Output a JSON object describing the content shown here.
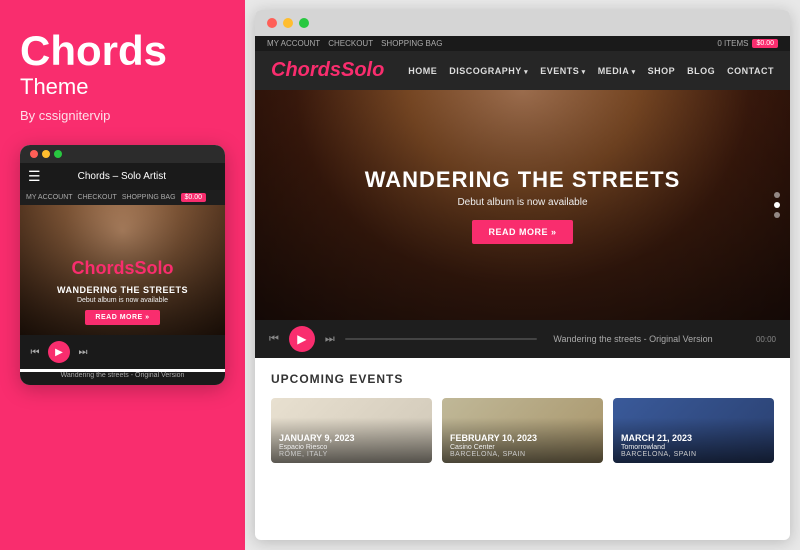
{
  "left": {
    "title": "Chords",
    "subtitle": "Theme",
    "by": "By cssignitervip"
  },
  "mobile": {
    "logo_text": "Chords",
    "logo_accent": "Solo",
    "nav_title": "Chords – Solo Artist",
    "account_links": [
      "MY ACCOUNT",
      "CHECKOUT",
      "SHOPPING BAG"
    ],
    "price": "$0.00",
    "hero_title": "WANDERING THE STREETS",
    "hero_subtitle": "Debut album is now available",
    "read_more": "READ MORE »",
    "player_track": "Wandering the streets - Original Version"
  },
  "browser": {
    "dots": [
      "red",
      "yellow",
      "green"
    ]
  },
  "website": {
    "topbar": {
      "links": [
        "MY ACCOUNT",
        "CHECKOUT",
        "SHOPPING BAG"
      ],
      "items_label": "0 ITEMS",
      "price": "$0.00"
    },
    "nav": {
      "logo": "Chords",
      "logo_accent": "Solo",
      "links": [
        {
          "label": "HOME",
          "has_arrow": false
        },
        {
          "label": "DISCOGRAPHY",
          "has_arrow": true
        },
        {
          "label": "EVENTS",
          "has_arrow": true
        },
        {
          "label": "MEDIA",
          "has_arrow": true
        },
        {
          "label": "SHOP",
          "has_arrow": false
        },
        {
          "label": "BLOG",
          "has_arrow": false
        },
        {
          "label": "CONTACT",
          "has_arrow": false
        }
      ]
    },
    "hero": {
      "title": "WANDERING THE STREETS",
      "subtitle": "Debut album is now available",
      "cta": "READ MORE »"
    },
    "player": {
      "track": "Wandering the streets - Original Version",
      "time": "00:00"
    },
    "events": {
      "section_title": "UPCOMING EVENTS",
      "items": [
        {
          "date": "JANUARY 9, 2023",
          "venue": "Espacio Riesco",
          "location": "ROME, ITALY"
        },
        {
          "date": "FEBRUARY 10, 2023",
          "venue": "Casino Center",
          "location": "BARCELONA, SPAIN"
        },
        {
          "date": "MARCH 21, 2023",
          "venue": "Tomorrowland",
          "location": "BARCELONA, SPAIN"
        }
      ]
    }
  }
}
